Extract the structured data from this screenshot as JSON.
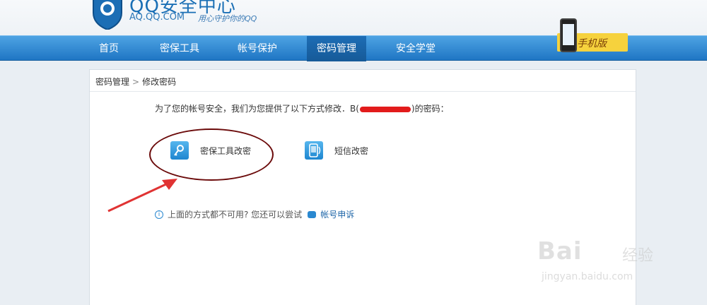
{
  "header": {
    "logo_title": "QQ安全中心",
    "logo_url": "AQ.QQ.COM",
    "logo_slogan": "用心守护你的QQ"
  },
  "nav": {
    "items": [
      {
        "label": "首页"
      },
      {
        "label": "密保工具"
      },
      {
        "label": "帐号保护"
      },
      {
        "label": "密码管理"
      },
      {
        "label": "安全学堂"
      }
    ],
    "active": "密码管理"
  },
  "mobile_badge": {
    "label": "手机版"
  },
  "breadcrumb": {
    "parent": "密码管理",
    "separator": ">",
    "current": "修改密码"
  },
  "intro": {
    "before": "为了您的帐号安全，我们为您提供了以下方式修改．B(",
    "after": ")的密码："
  },
  "options": [
    {
      "label": "密保工具改密",
      "icon": "key-icon"
    },
    {
      "label": "短信改密",
      "icon": "sms-icon"
    }
  ],
  "hint": {
    "text": "上面的方式都不可用? 您还可以尝试",
    "link": "帐号申诉"
  },
  "watermark": {
    "brand": "Bai",
    "brand_cn": "经验",
    "url": "jingyan.baidu.com"
  },
  "colors": {
    "nav": "#1f76c4",
    "annotation": "#6b0a0a",
    "arrow": "#e03333",
    "redaction": "#e21b1b"
  }
}
